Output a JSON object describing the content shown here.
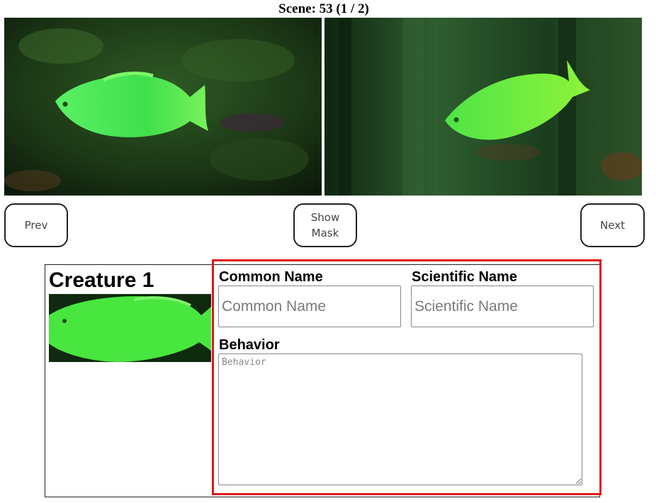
{
  "scene": {
    "title": "Scene: 53 (1 / 2)"
  },
  "images": {
    "left": {
      "icon": "fish-photo-left",
      "fish_color": "#5bf25f",
      "background": "#1f3d1a"
    },
    "right": {
      "icon": "fish-photo-right",
      "fish_color": "#64ef3a",
      "background": "#1c3a20"
    }
  },
  "navigation": {
    "prev_label": "Prev",
    "show_mask_label_line1": "Show",
    "show_mask_label_line2": "Mask",
    "next_label": "Next"
  },
  "creature": {
    "title": "Creature 1",
    "thumbnail_icon": "fish-thumbnail",
    "fields": {
      "common_name": {
        "label": "Common Name",
        "placeholder": "Common Name",
        "value": ""
      },
      "scientific_name": {
        "label": "Scientific Name",
        "placeholder": "Scientific Name",
        "value": ""
      },
      "behavior": {
        "label": "Behavior",
        "placeholder": "Behavior",
        "value": ""
      }
    }
  },
  "colors": {
    "highlight_border": "#e41414",
    "button_border": "#222222"
  }
}
